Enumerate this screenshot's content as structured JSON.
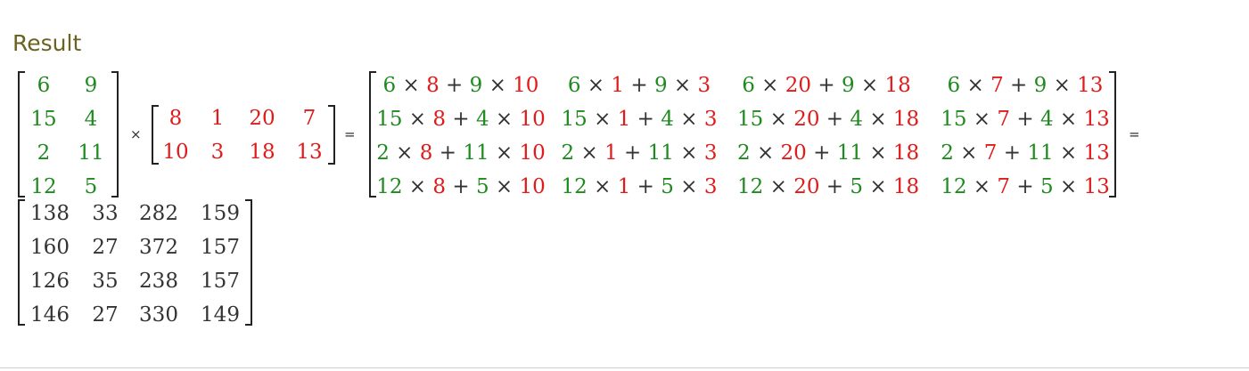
{
  "heading": "Result",
  "operators": {
    "times": "×",
    "equals": "="
  },
  "colors": {
    "left": "#1f8a1f",
    "right": "#e01b1b",
    "result": "#333333"
  },
  "matrix_a": [
    [
      "6",
      "9"
    ],
    [
      "15",
      "4"
    ],
    [
      "2",
      "11"
    ],
    [
      "12",
      "5"
    ]
  ],
  "matrix_b": [
    [
      "8",
      "1",
      "20",
      "7"
    ],
    [
      "10",
      "3",
      "18",
      "13"
    ]
  ],
  "expanded": [
    [
      [
        {
          "t": "6",
          "c": "g"
        },
        {
          "t": " × ",
          "c": "k"
        },
        {
          "t": "8",
          "c": "r"
        },
        {
          "t": " + ",
          "c": "k"
        },
        {
          "t": "9",
          "c": "g"
        },
        {
          "t": " × ",
          "c": "k"
        },
        {
          "t": "10",
          "c": "r"
        }
      ],
      [
        {
          "t": "6",
          "c": "g"
        },
        {
          "t": " × ",
          "c": "k"
        },
        {
          "t": "1",
          "c": "r"
        },
        {
          "t": " + ",
          "c": "k"
        },
        {
          "t": "9",
          "c": "g"
        },
        {
          "t": " × ",
          "c": "k"
        },
        {
          "t": "3",
          "c": "r"
        }
      ],
      [
        {
          "t": "6",
          "c": "g"
        },
        {
          "t": " × ",
          "c": "k"
        },
        {
          "t": "20",
          "c": "r"
        },
        {
          "t": " + ",
          "c": "k"
        },
        {
          "t": "9",
          "c": "g"
        },
        {
          "t": " × ",
          "c": "k"
        },
        {
          "t": "18",
          "c": "r"
        }
      ],
      [
        {
          "t": "6",
          "c": "g"
        },
        {
          "t": " × ",
          "c": "k"
        },
        {
          "t": "7",
          "c": "r"
        },
        {
          "t": " + ",
          "c": "k"
        },
        {
          "t": "9",
          "c": "g"
        },
        {
          "t": " × ",
          "c": "k"
        },
        {
          "t": "13",
          "c": "r"
        }
      ]
    ],
    [
      [
        {
          "t": "15",
          "c": "g"
        },
        {
          "t": " × ",
          "c": "k"
        },
        {
          "t": "8",
          "c": "r"
        },
        {
          "t": " + ",
          "c": "k"
        },
        {
          "t": "4",
          "c": "g"
        },
        {
          "t": " × ",
          "c": "k"
        },
        {
          "t": "10",
          "c": "r"
        }
      ],
      [
        {
          "t": "15",
          "c": "g"
        },
        {
          "t": " × ",
          "c": "k"
        },
        {
          "t": "1",
          "c": "r"
        },
        {
          "t": " + ",
          "c": "k"
        },
        {
          "t": "4",
          "c": "g"
        },
        {
          "t": " × ",
          "c": "k"
        },
        {
          "t": "3",
          "c": "r"
        }
      ],
      [
        {
          "t": "15",
          "c": "g"
        },
        {
          "t": " × ",
          "c": "k"
        },
        {
          "t": "20",
          "c": "r"
        },
        {
          "t": " + ",
          "c": "k"
        },
        {
          "t": "4",
          "c": "g"
        },
        {
          "t": " × ",
          "c": "k"
        },
        {
          "t": "18",
          "c": "r"
        }
      ],
      [
        {
          "t": "15",
          "c": "g"
        },
        {
          "t": " × ",
          "c": "k"
        },
        {
          "t": "7",
          "c": "r"
        },
        {
          "t": " + ",
          "c": "k"
        },
        {
          "t": "4",
          "c": "g"
        },
        {
          "t": " × ",
          "c": "k"
        },
        {
          "t": "13",
          "c": "r"
        }
      ]
    ],
    [
      [
        {
          "t": "2",
          "c": "g"
        },
        {
          "t": " × ",
          "c": "k"
        },
        {
          "t": "8",
          "c": "r"
        },
        {
          "t": " + ",
          "c": "k"
        },
        {
          "t": "11",
          "c": "g"
        },
        {
          "t": " × ",
          "c": "k"
        },
        {
          "t": "10",
          "c": "r"
        }
      ],
      [
        {
          "t": "2",
          "c": "g"
        },
        {
          "t": " × ",
          "c": "k"
        },
        {
          "t": "1",
          "c": "r"
        },
        {
          "t": " + ",
          "c": "k"
        },
        {
          "t": "11",
          "c": "g"
        },
        {
          "t": " × ",
          "c": "k"
        },
        {
          "t": "3",
          "c": "r"
        }
      ],
      [
        {
          "t": "2",
          "c": "g"
        },
        {
          "t": " × ",
          "c": "k"
        },
        {
          "t": "20",
          "c": "r"
        },
        {
          "t": " + ",
          "c": "k"
        },
        {
          "t": "11",
          "c": "g"
        },
        {
          "t": " × ",
          "c": "k"
        },
        {
          "t": "18",
          "c": "r"
        }
      ],
      [
        {
          "t": "2",
          "c": "g"
        },
        {
          "t": " × ",
          "c": "k"
        },
        {
          "t": "7",
          "c": "r"
        },
        {
          "t": " + ",
          "c": "k"
        },
        {
          "t": "11",
          "c": "g"
        },
        {
          "t": " × ",
          "c": "k"
        },
        {
          "t": "13",
          "c": "r"
        }
      ]
    ],
    [
      [
        {
          "t": "12",
          "c": "g"
        },
        {
          "t": " × ",
          "c": "k"
        },
        {
          "t": "8",
          "c": "r"
        },
        {
          "t": " + ",
          "c": "k"
        },
        {
          "t": "5",
          "c": "g"
        },
        {
          "t": " × ",
          "c": "k"
        },
        {
          "t": "10",
          "c": "r"
        }
      ],
      [
        {
          "t": "12",
          "c": "g"
        },
        {
          "t": " × ",
          "c": "k"
        },
        {
          "t": "1",
          "c": "r"
        },
        {
          "t": " + ",
          "c": "k"
        },
        {
          "t": "5",
          "c": "g"
        },
        {
          "t": " × ",
          "c": "k"
        },
        {
          "t": "3",
          "c": "r"
        }
      ],
      [
        {
          "t": "12",
          "c": "g"
        },
        {
          "t": " × ",
          "c": "k"
        },
        {
          "t": "20",
          "c": "r"
        },
        {
          "t": " + ",
          "c": "k"
        },
        {
          "t": "5",
          "c": "g"
        },
        {
          "t": " × ",
          "c": "k"
        },
        {
          "t": "18",
          "c": "r"
        }
      ],
      [
        {
          "t": "12",
          "c": "g"
        },
        {
          "t": " × ",
          "c": "k"
        },
        {
          "t": "7",
          "c": "r"
        },
        {
          "t": " + ",
          "c": "k"
        },
        {
          "t": "5",
          "c": "g"
        },
        {
          "t": " × ",
          "c": "k"
        },
        {
          "t": "13",
          "c": "r"
        }
      ]
    ]
  ],
  "result": [
    [
      "138",
      "33",
      "282",
      "159"
    ],
    [
      "160",
      "27",
      "372",
      "157"
    ],
    [
      "126",
      "35",
      "238",
      "157"
    ],
    [
      "146",
      "27",
      "330",
      "149"
    ]
  ]
}
